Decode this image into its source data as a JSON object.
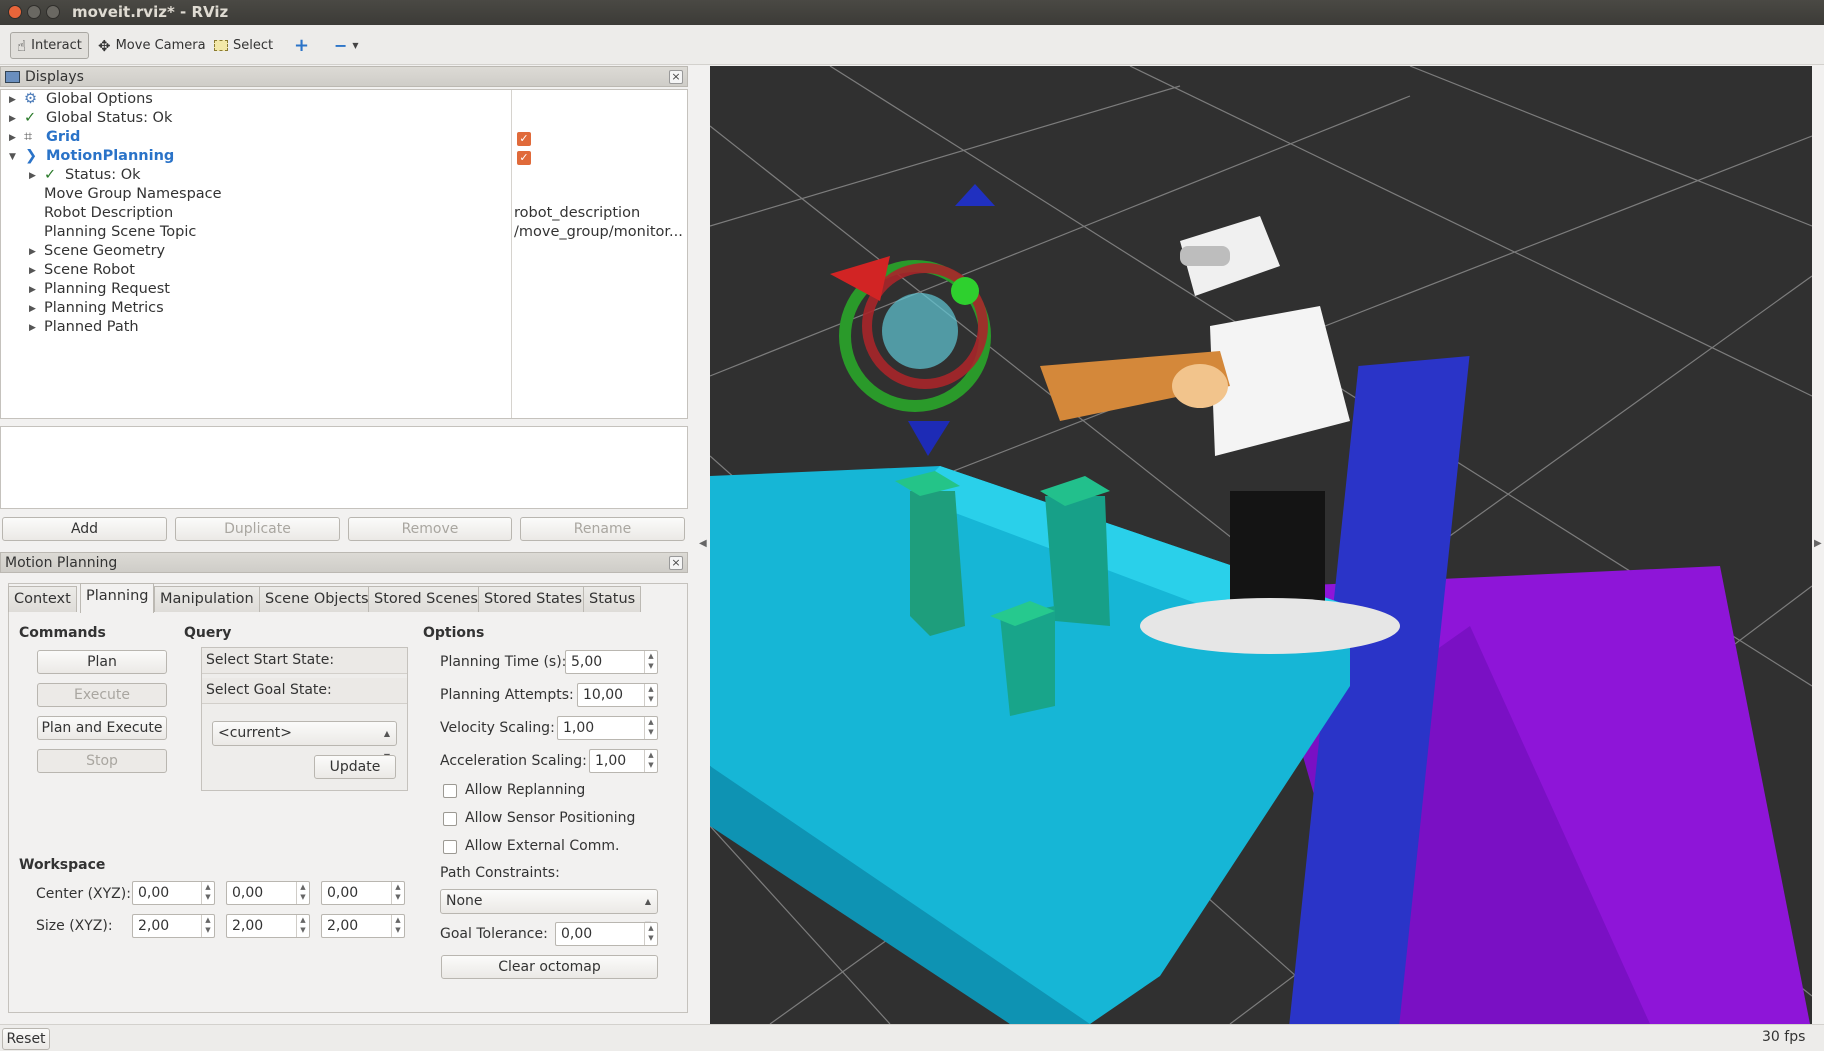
{
  "window": {
    "title": "moveit.rviz* - RViz"
  },
  "toolbar": {
    "interact": "Interact",
    "move_camera": "Move Camera",
    "select": "Select"
  },
  "displays_panel": {
    "title": "Displays",
    "items": [
      {
        "label": "Global Options",
        "icon": "gear-icon"
      },
      {
        "label": "Global Status: Ok",
        "icon": "check-icon"
      },
      {
        "label": "Grid",
        "icon": "grid-icon",
        "checked": true
      },
      {
        "label": "MotionPlanning",
        "icon": "motion-planning-icon",
        "checked": true
      },
      {
        "label": "Status: Ok",
        "icon": "check-icon"
      },
      {
        "label": "Move Group Namespace",
        "value": ""
      },
      {
        "label": "Robot Description",
        "value": "robot_description"
      },
      {
        "label": "Planning Scene Topic",
        "value": "/move_group/monitor..."
      },
      {
        "label": "Scene Geometry"
      },
      {
        "label": "Scene Robot"
      },
      {
        "label": "Planning Request"
      },
      {
        "label": "Planning Metrics"
      },
      {
        "label": "Planned Path"
      }
    ],
    "buttons": {
      "add": "Add",
      "duplicate": "Duplicate",
      "remove": "Remove",
      "rename": "Rename"
    }
  },
  "motion_planning": {
    "title": "Motion Planning",
    "tabs": [
      "Context",
      "Planning",
      "Manipulation",
      "Scene Objects",
      "Stored Scenes",
      "Stored States",
      "Status"
    ],
    "active_tab": "Planning",
    "commands": {
      "title": "Commands",
      "plan": "Plan",
      "execute": "Execute",
      "plan_execute": "Plan and Execute",
      "stop": "Stop"
    },
    "query": {
      "title": "Query",
      "start": "Select Start State:",
      "goal": "Select Goal State:",
      "current": "<current>",
      "update": "Update"
    },
    "options": {
      "title": "Options",
      "planning_time_label": "Planning Time (s):",
      "planning_time": "5,00",
      "planning_attempts_label": "Planning Attempts:",
      "planning_attempts": "10,00",
      "velocity_label": "Velocity Scaling:",
      "velocity": "1,00",
      "accel_label": "Acceleration Scaling:",
      "accel": "1,00",
      "allow_replanning": "Allow Replanning",
      "allow_sensor": "Allow Sensor Positioning",
      "allow_external": "Allow External Comm.",
      "path_constraints_label": "Path Constraints:",
      "path_constraints": "None",
      "goal_tolerance_label": "Goal Tolerance:",
      "goal_tolerance": "0,00",
      "clear_octomap": "Clear octomap"
    },
    "workspace": {
      "title": "Workspace",
      "center_label": "Center (XYZ):",
      "center": [
        "0,00",
        "0,00",
        "0,00"
      ],
      "size_label": "Size (XYZ):",
      "size": [
        "2,00",
        "2,00",
        "2,00"
      ]
    }
  },
  "status": {
    "reset": "Reset",
    "fps": "30 fps"
  }
}
